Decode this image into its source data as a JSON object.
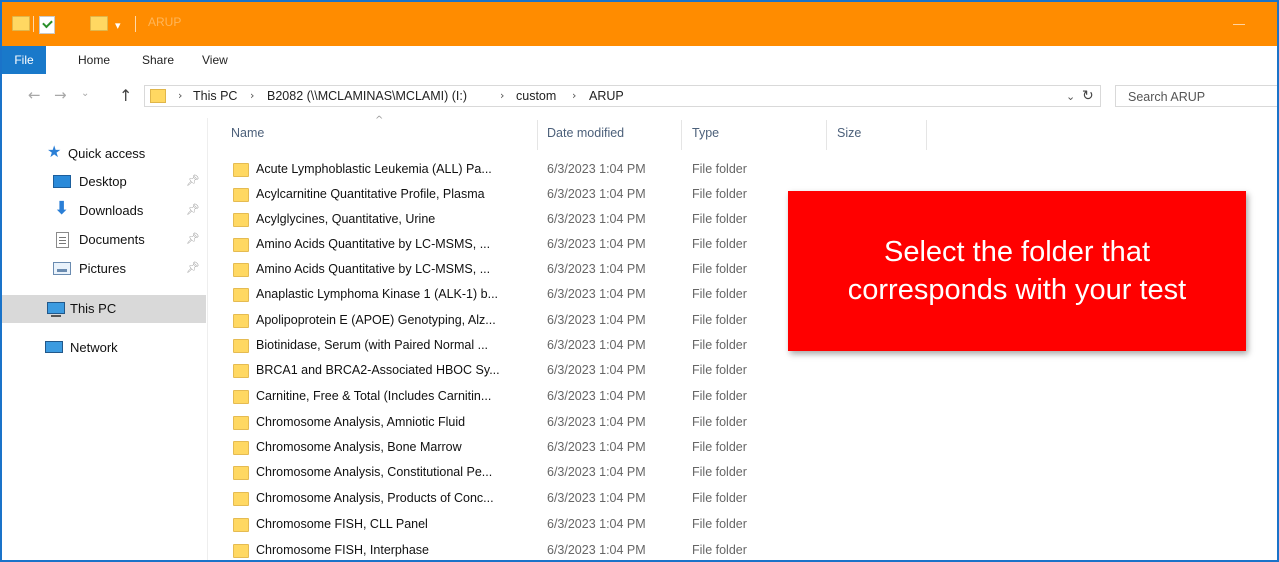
{
  "window": {
    "title": "ARUP",
    "colors": {
      "titlebar": "#ff8c00",
      "file_tab": "#1979ca",
      "callout": "#ff0000"
    }
  },
  "ribbon": {
    "tabs": [
      {
        "label": "File"
      },
      {
        "label": "Home"
      },
      {
        "label": "Share"
      },
      {
        "label": "View"
      }
    ]
  },
  "address": {
    "crumbs": [
      "This PC",
      "B2082 (\\\\MCLAMINAS\\MCLAMI) (I:)",
      "custom",
      "ARUP"
    ],
    "search_placeholder": "Search ARUP"
  },
  "nav": {
    "quick_access": "Quick access",
    "items": [
      {
        "label": "Desktop",
        "icon": "desktop-icon"
      },
      {
        "label": "Downloads",
        "icon": "download-icon"
      },
      {
        "label": "Documents",
        "icon": "document-icon"
      },
      {
        "label": "Pictures",
        "icon": "picture-icon"
      }
    ],
    "this_pc": "This PC",
    "network": "Network"
  },
  "columns": {
    "name": "Name",
    "date": "Date modified",
    "type": "Type",
    "size": "Size"
  },
  "files": [
    {
      "name": "Acute Lymphoblastic Leukemia (ALL) Pa...",
      "date": "6/3/2023 1:04 PM",
      "type": "File folder"
    },
    {
      "name": "Acylcarnitine Quantitative Profile, Plasma",
      "date": "6/3/2023 1:04 PM",
      "type": "File folder"
    },
    {
      "name": "Acylglycines, Quantitative, Urine",
      "date": "6/3/2023 1:04 PM",
      "type": "File folder"
    },
    {
      "name": "Amino Acids Quantitative by LC-MSMS, ...",
      "date": "6/3/2023 1:04 PM",
      "type": "File folder"
    },
    {
      "name": "Amino Acids Quantitative by LC-MSMS, ...",
      "date": "6/3/2023 1:04 PM",
      "type": "File folder"
    },
    {
      "name": "Anaplastic Lymphoma Kinase 1 (ALK-1) b...",
      "date": "6/3/2023 1:04 PM",
      "type": "File folder"
    },
    {
      "name": "Apolipoprotein E (APOE) Genotyping, Alz...",
      "date": "6/3/2023 1:04 PM",
      "type": "File folder"
    },
    {
      "name": "Biotinidase, Serum (with Paired Normal ...",
      "date": "6/3/2023 1:04 PM",
      "type": "File folder"
    },
    {
      "name": "BRCA1 and BRCA2-Associated HBOC Sy...",
      "date": "6/3/2023 1:04 PM",
      "type": "File folder"
    },
    {
      "name": "Carnitine, Free & Total (Includes Carnitin...",
      "date": "6/3/2023 1:04 PM",
      "type": "File folder"
    },
    {
      "name": "Chromosome Analysis, Amniotic Fluid",
      "date": "6/3/2023 1:04 PM",
      "type": "File folder"
    },
    {
      "name": "Chromosome Analysis, Bone Marrow",
      "date": "6/3/2023 1:04 PM",
      "type": "File folder"
    },
    {
      "name": "Chromosome Analysis, Constitutional Pe...",
      "date": "6/3/2023 1:04 PM",
      "type": "File folder"
    },
    {
      "name": "Chromosome Analysis, Products of Conc...",
      "date": "6/3/2023 1:04 PM",
      "type": "File folder"
    },
    {
      "name": "Chromosome FISH, CLL Panel",
      "date": "6/3/2023 1:04 PM",
      "type": "File folder"
    },
    {
      "name": "Chromosome FISH, Interphase",
      "date": "6/3/2023 1:04 PM",
      "type": "File folder"
    }
  ],
  "callout": {
    "text": "Select the folder that corresponds with your test"
  }
}
